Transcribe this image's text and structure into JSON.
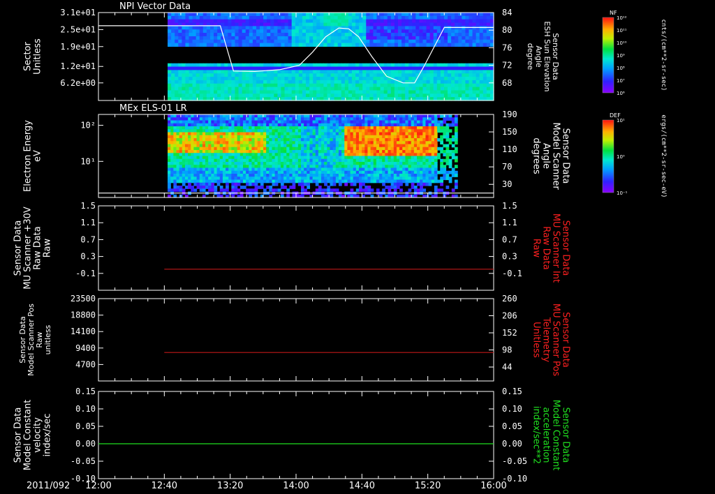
{
  "chart_data": [
    {
      "type": "heatmap",
      "title": "NPI Vector Data",
      "ylabel": "Sector Unitless",
      "y_ticks": [
        "3.1e+01",
        "2.5e+01",
        "1.9e+01",
        "1.2e+01",
        "6.2e+00"
      ],
      "y_tick_values": [
        31,
        25,
        19,
        12,
        6.2
      ],
      "ylim": [
        0,
        31
      ],
      "right_ylabel": [
        "Sensor Data",
        "ESH Sun Elevation",
        "Angle",
        "degree"
      ],
      "right_y_ticks": [
        "84",
        "80",
        "76",
        "72",
        "68"
      ],
      "right_y_tick_values": [
        84,
        80,
        76,
        72,
        68
      ],
      "right_ylim": [
        64,
        84
      ],
      "data_start": "12:42",
      "data_end": "16:00",
      "colorbar": {
        "label": "NF",
        "units": "cnts/(cm**2-sr-sec)",
        "ticks": [
          "10¹²",
          "10¹¹",
          "10¹⁰",
          "10⁹",
          "10⁸",
          "10⁷",
          "10⁶"
        ],
        "log_min": 6,
        "log_max": 12
      },
      "series": [
        {
          "axis": "right",
          "color": "#ffffff",
          "x": [
            "12:00",
            "12:40",
            "13:14",
            "13:22",
            "13:35",
            "13:50",
            "14:02",
            "14:10",
            "14:18",
            "14:26",
            "14:32",
            "14:38",
            "14:46",
            "14:55",
            "15:05",
            "15:12",
            "15:18",
            "15:30",
            "16:00"
          ],
          "y": [
            81,
            81,
            81,
            70.7,
            70.6,
            71,
            72,
            75,
            78.5,
            80.5,
            80.3,
            78.5,
            74,
            69.5,
            68,
            68,
            72,
            80.6,
            80.6
          ]
        }
      ]
    },
    {
      "type": "heatmap",
      "title": "MEx ELS-01 LR",
      "ylabel": "Electron Energy eV",
      "y_ticks": [
        "10²",
        "10¹"
      ],
      "y_tick_values": [
        100,
        10
      ],
      "ylim": [
        1,
        200
      ],
      "yscale": "log",
      "right_ylabel": [
        "Sensor Data",
        "Model Scanner",
        "Angle",
        "degrees"
      ],
      "right_y_ticks": [
        "190",
        "150",
        "110",
        "70",
        "30"
      ],
      "right_y_tick_values": [
        190,
        150,
        110,
        70,
        30
      ],
      "right_ylim": [
        0,
        190
      ],
      "data_start": "12:42",
      "data_end": "15:38",
      "colorbar": {
        "label": "DEF",
        "units": "ergs/(cm**2-sr-sec-eV)",
        "ticks": [
          "10¹",
          "10⁰",
          "10⁻¹"
        ],
        "log_min": -1,
        "log_max": 1
      },
      "series": [
        {
          "axis": "right",
          "color": "#ffffff",
          "x": [
            "12:00",
            "16:00"
          ],
          "y": [
            10,
            10
          ]
        }
      ]
    },
    {
      "type": "line",
      "ylabel": [
        "Sensor Data",
        "MU Scanner +30V",
        "Raw Data",
        "Raw"
      ],
      "y_ticks": [
        "1.5",
        "1.1",
        "0.7",
        "0.3",
        "-0.1"
      ],
      "y_tick_values": [
        1.5,
        1.1,
        0.7,
        0.3,
        -0.1
      ],
      "ylim": [
        -0.5,
        1.5
      ],
      "right_ylabel": [
        "Sensor Data",
        "MU Scanner Int",
        "Raw Data",
        "Raw"
      ],
      "right_color": "#ff2020",
      "right_y_ticks": [
        "1.5",
        "1.1",
        "0.7",
        "0.3",
        "-0.1"
      ],
      "right_y_tick_values": [
        1.5,
        1.1,
        0.7,
        0.3,
        -0.1
      ],
      "right_ylim": [
        -0.5,
        1.5
      ],
      "series": [
        {
          "axis": "right",
          "color": "#c01818",
          "x": [
            "12:40",
            "16:00"
          ],
          "y": [
            0,
            0
          ]
        }
      ]
    },
    {
      "type": "line",
      "ylabel": [
        "Sensor Data",
        "Model Scanner Pos",
        "Raw",
        "unitless"
      ],
      "y_ticks": [
        "23500",
        "18800",
        "14100",
        "9400",
        "4700"
      ],
      "y_tick_values": [
        23500,
        18800,
        14100,
        9400,
        4700
      ],
      "ylim": [
        0,
        23500
      ],
      "right_ylabel": [
        "Sensor Data",
        "MU Scanner Pos",
        "Telemetry",
        "Unitless"
      ],
      "right_color": "#ff2020",
      "right_y_ticks": [
        "260",
        "206",
        "152",
        "98",
        "44"
      ],
      "right_y_tick_values": [
        260,
        206,
        152,
        98,
        44
      ],
      "right_ylim": [
        0,
        260
      ],
      "series": [
        {
          "axis": "right",
          "color": "#c01818",
          "x": [
            "12:40",
            "16:00"
          ],
          "y": [
            90,
            90
          ]
        }
      ]
    },
    {
      "type": "line",
      "ylabel": [
        "Sensor Data",
        "Model Constant",
        "velocity",
        "index/sec"
      ],
      "y_ticks": [
        "0.15",
        "0.10",
        "0.05",
        "0.00",
        "-0.05",
        "-0.10"
      ],
      "y_tick_values": [
        0.15,
        0.1,
        0.05,
        0,
        -0.05,
        -0.1
      ],
      "ylim": [
        -0.1,
        0.15
      ],
      "right_ylabel": [
        "Sensor Data",
        "Model Constant",
        "acceleration",
        "index/sec**2"
      ],
      "right_color": "#20e020",
      "right_y_ticks": [
        "0.15",
        "0.10",
        "0.05",
        "0.00",
        "-0.05",
        "-0.10"
      ],
      "right_y_tick_values": [
        0.15,
        0.1,
        0.05,
        0,
        -0.05,
        -0.1
      ],
      "right_ylim": [
        -0.1,
        0.15
      ],
      "series": [
        {
          "axis": "right",
          "color": "#20e020",
          "x": [
            "12:00",
            "16:00"
          ],
          "y": [
            0,
            0
          ]
        }
      ]
    }
  ],
  "x_axis": {
    "date_label": "2011/092",
    "ticks": [
      "12:00",
      "12:40",
      "13:20",
      "14:00",
      "14:40",
      "15:20",
      "16:00"
    ],
    "xlim": [
      "12:00",
      "16:00"
    ]
  }
}
